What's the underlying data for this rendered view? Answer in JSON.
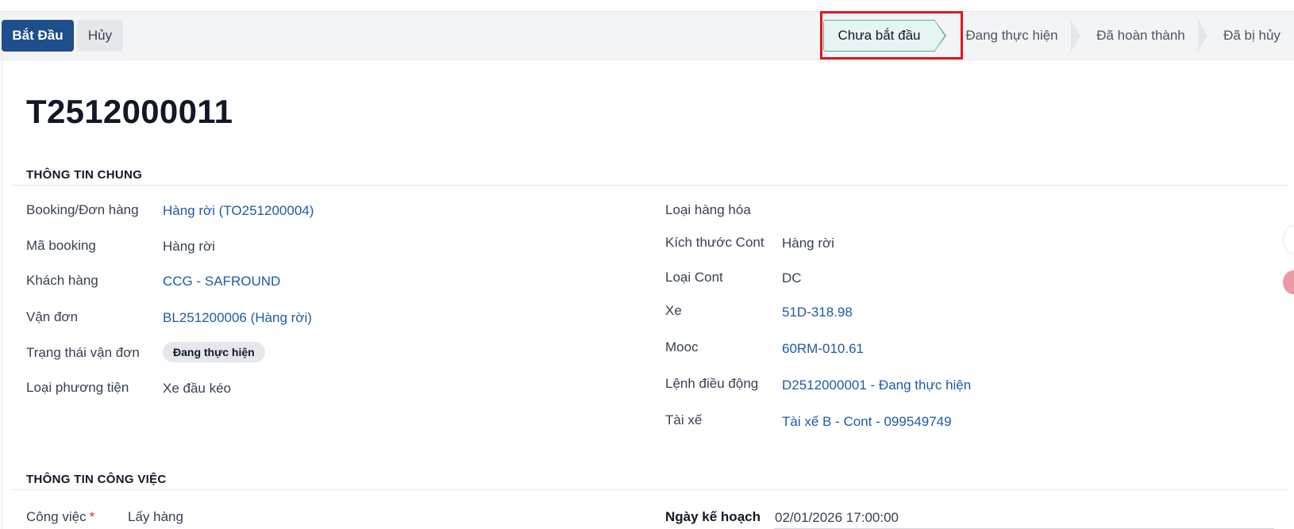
{
  "toolbar": {
    "start_label": "Bắt Đầu",
    "cancel_label": "Hủy"
  },
  "stages": [
    {
      "label": "Chưa bắt đầu",
      "active": true
    },
    {
      "label": "Đang thực hiện",
      "active": false
    },
    {
      "label": "Đã hoàn thành",
      "active": false
    },
    {
      "label": "Đã bị hủy",
      "active": false
    }
  ],
  "record": {
    "title": "T2512000011"
  },
  "general_section": {
    "title": "THÔNG TIN CHUNG",
    "left": [
      {
        "label": "Booking/Đơn hàng",
        "value": "Hàng rời (TO251200004)"
      },
      {
        "label": "Mã booking",
        "value": "Hàng rời"
      },
      {
        "label": "Khách hàng",
        "value": "CCG - SAFROUND"
      },
      {
        "label": "Vận đơn",
        "value": "BL251200006 (Hàng rời)"
      },
      {
        "label": "Trạng thái vận đơn",
        "value": "Đang thực hiện"
      },
      {
        "label": "Loại phương tiện",
        "value": "Xe đầu kéo"
      }
    ],
    "right": [
      {
        "label": "Loại hàng hóa",
        "value": ""
      },
      {
        "label": "Kích thước Cont",
        "value": "Hàng rời"
      },
      {
        "label": "Loại Cont",
        "value": "DC"
      },
      {
        "label": "Xe",
        "value": "51D-318.98"
      },
      {
        "label": "Mooc",
        "value": "60RM-010.61"
      },
      {
        "label": "Lệnh điều động",
        "value": "D2512000001 - Đang thực hiện"
      },
      {
        "label": "Tài xế",
        "value": "Tài xế B - Cont - 099549749"
      }
    ]
  },
  "job_section": {
    "title": "THÔNG TIN CÔNG VIỆC",
    "job_label": "Công việc",
    "required_mark": "*",
    "job_value": "Lấy hàng",
    "plan_date_label": "Ngày kế hoạch",
    "plan_date_value": "02/01/2026 17:00:00"
  },
  "colors": {
    "primary": "#1f4e8c",
    "link": "#1f5aa6",
    "active_stage": "#e6f5f3",
    "highlight": "#e3161b"
  }
}
